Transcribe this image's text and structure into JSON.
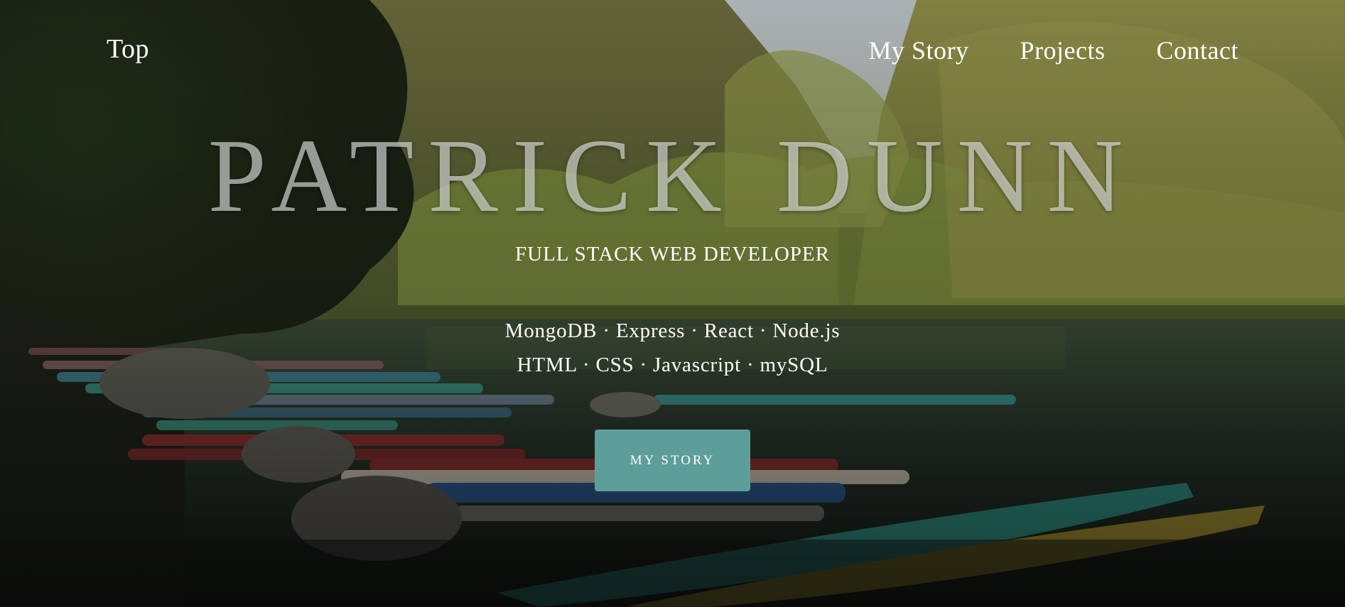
{
  "nav": {
    "top_label": "Top",
    "links": [
      "My Story",
      "Projects",
      "Contact"
    ]
  },
  "hero": {
    "name": "PATRICK DUNN",
    "subtitle": "FULL STACK WEB DEVELOPER",
    "tech_line_1": "MongoDB · Express · React · Node.js",
    "tech_line_2": "HTML · CSS · Javascript · mySQL",
    "cta_label": "MY STORY"
  },
  "colors": {
    "cta_background": "#5e9e9a",
    "text": "#ffffff"
  }
}
